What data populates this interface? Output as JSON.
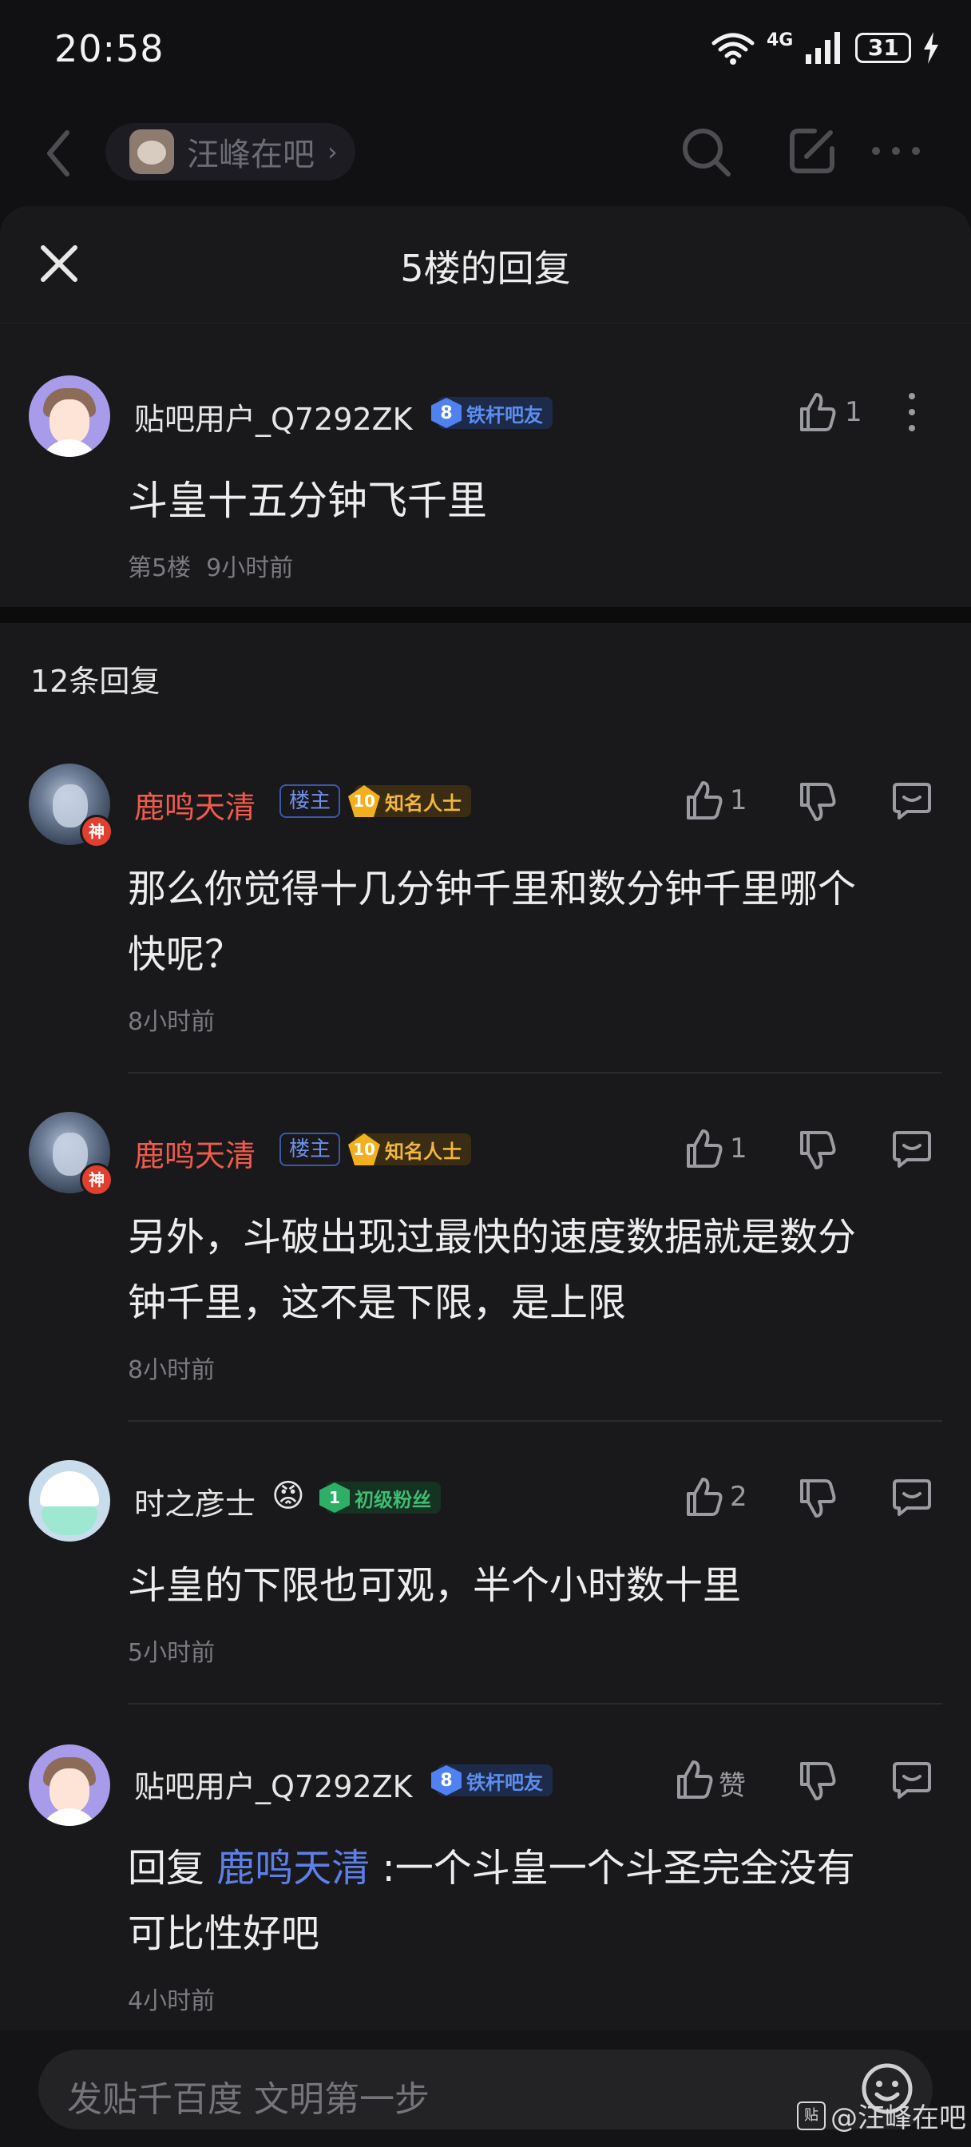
{
  "status_bar": {
    "time": "20:58",
    "network": "4G",
    "wifi_level": "6",
    "battery": "31"
  },
  "nav": {
    "forum_name": "汪峰在吧"
  },
  "sheet": {
    "title": "5楼的回复"
  },
  "main_post": {
    "user": "贴吧用户_Q7292ZK",
    "level": "8",
    "level_title": "铁杆吧友",
    "likes": "1",
    "content": "斗皇十五分钟飞千里",
    "floor": "第5楼",
    "time": "9小时前"
  },
  "replies_count": "12条回复",
  "replies": [
    {
      "user": "鹿鸣天清",
      "role": "楼主",
      "level": "10",
      "level_title": "知名人士",
      "god_badge": "神",
      "likes": "1",
      "content_line1": "那么你觉得十几分钟千里和数分钟千里哪个",
      "content_line2": "快呢？",
      "time": "8小时前"
    },
    {
      "user": "鹿鸣天清",
      "role": "楼主",
      "level": "10",
      "level_title": "知名人士",
      "god_badge": "神",
      "likes": "1",
      "content_line1": "另外，斗破出现过最快的速度数据就是数分",
      "content_line2": "钟千里，这不是下限，是上限",
      "time": "8小时前"
    },
    {
      "user": "时之彦士",
      "emoji": "😡",
      "level": "1",
      "level_title": "初级粉丝",
      "likes": "2",
      "content_line1": "斗皇的下限也可观，半个小时数十里",
      "time": "5小时前"
    },
    {
      "user": "贴吧用户_Q7292ZK",
      "level": "8",
      "level_title": "铁杆吧友",
      "likes": "赞",
      "reply_prefix": "回复 ",
      "mention": "鹿鸣天清",
      "content_after_mention": " :一个斗皇一个斗圣完全没有",
      "content_line2": "可比性好吧",
      "time": "4小时前"
    }
  ],
  "bottom_bar": {
    "placeholder": "发贴千百度 文明第一步"
  },
  "watermark": {
    "logo": "贴",
    "text": "@汪峰在吧"
  }
}
